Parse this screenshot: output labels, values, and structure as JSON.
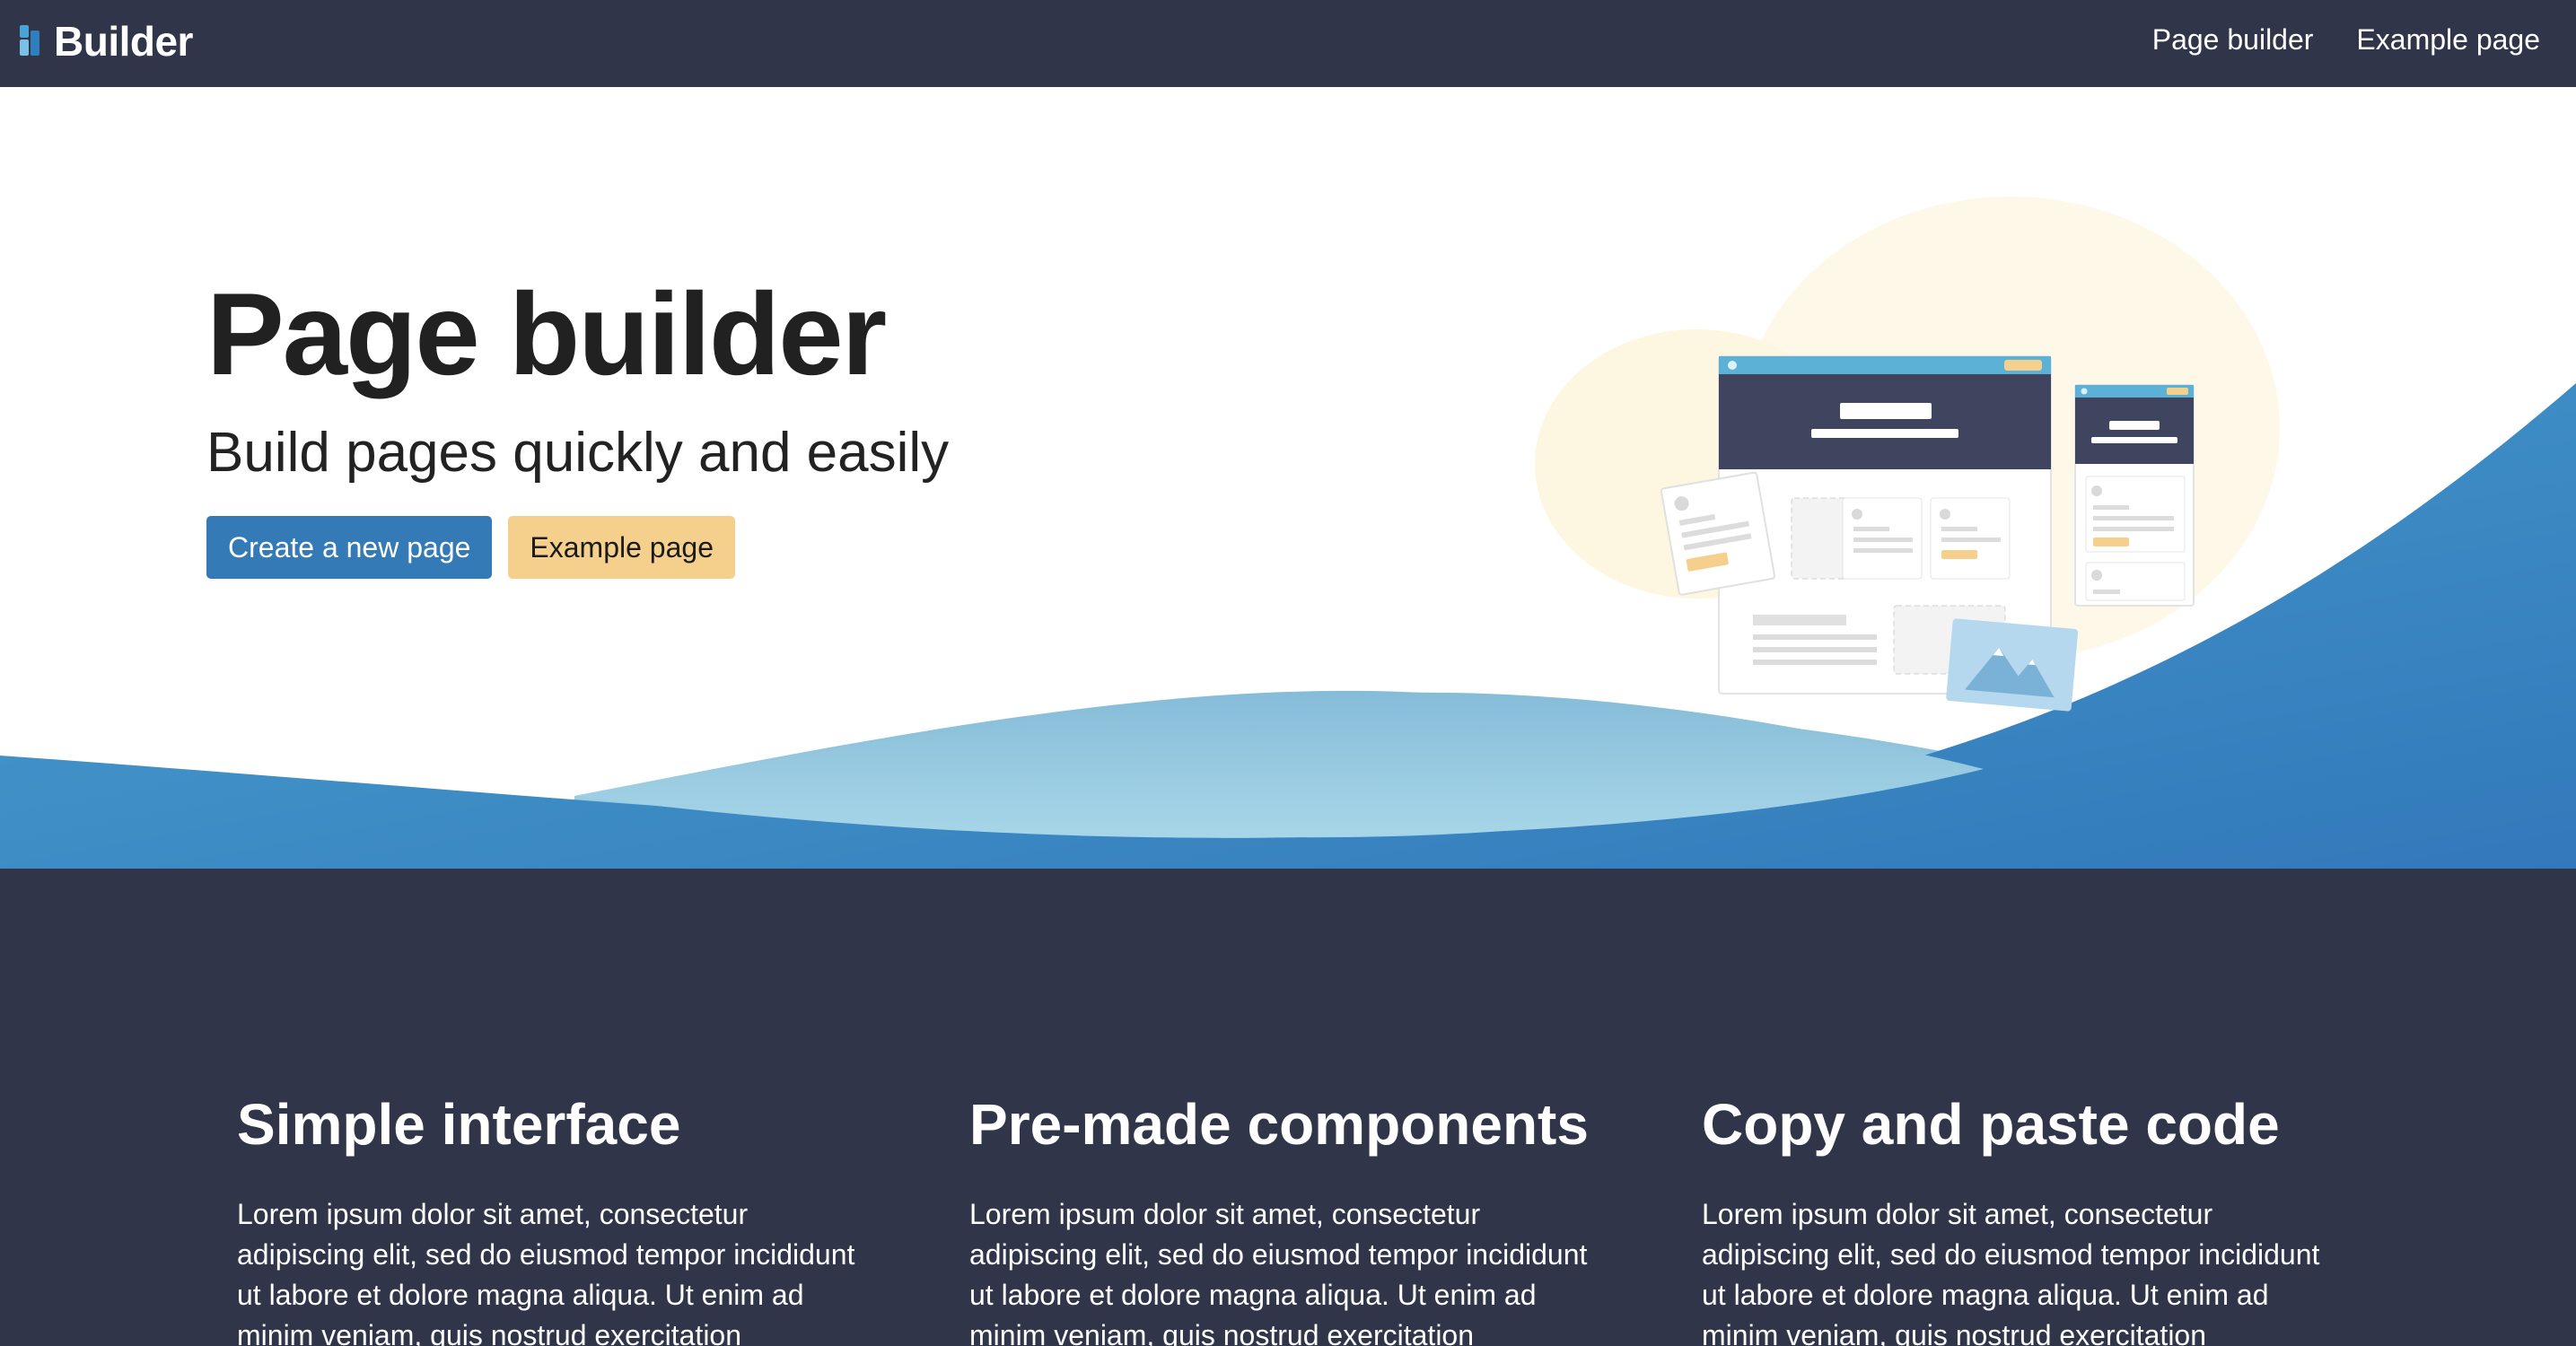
{
  "navbar": {
    "brand": "Builder",
    "links": [
      "Page builder",
      "Example page"
    ]
  },
  "hero": {
    "title": "Page builder",
    "subtitle": "Build pages quickly and easily",
    "primary_button": "Create a new page",
    "secondary_button": "Example page"
  },
  "features": [
    {
      "title": "Simple interface",
      "body": "Lorem ipsum dolor sit amet, consectetur adipiscing elit, sed do eiusmod tempor incididunt ut labore et dolore magna aliqua. Ut enim ad minim veniam, quis nostrud exercitation"
    },
    {
      "title": "Pre-made components",
      "body": "Lorem ipsum dolor sit amet, consectetur adipiscing elit, sed do eiusmod tempor incididunt ut labore et dolore magna aliqua. Ut enim ad minim veniam, quis nostrud exercitation"
    },
    {
      "title": "Copy and paste code",
      "body": "Lorem ipsum dolor sit amet, consectetur adipiscing elit, sed do eiusmod tempor incididunt ut labore et dolore magna aliqua. Ut enim ad minim veniam, quis nostrud exercitation"
    }
  ],
  "colors": {
    "navbar_bg": "#30354a",
    "primary": "#337ab7",
    "warning": "#f5d08c",
    "wave_light": "#9ecde2",
    "wave_dark": "#3380be"
  },
  "icons": {
    "brand": "builder-logo-icon",
    "illustration": "page-builder-illustration"
  }
}
